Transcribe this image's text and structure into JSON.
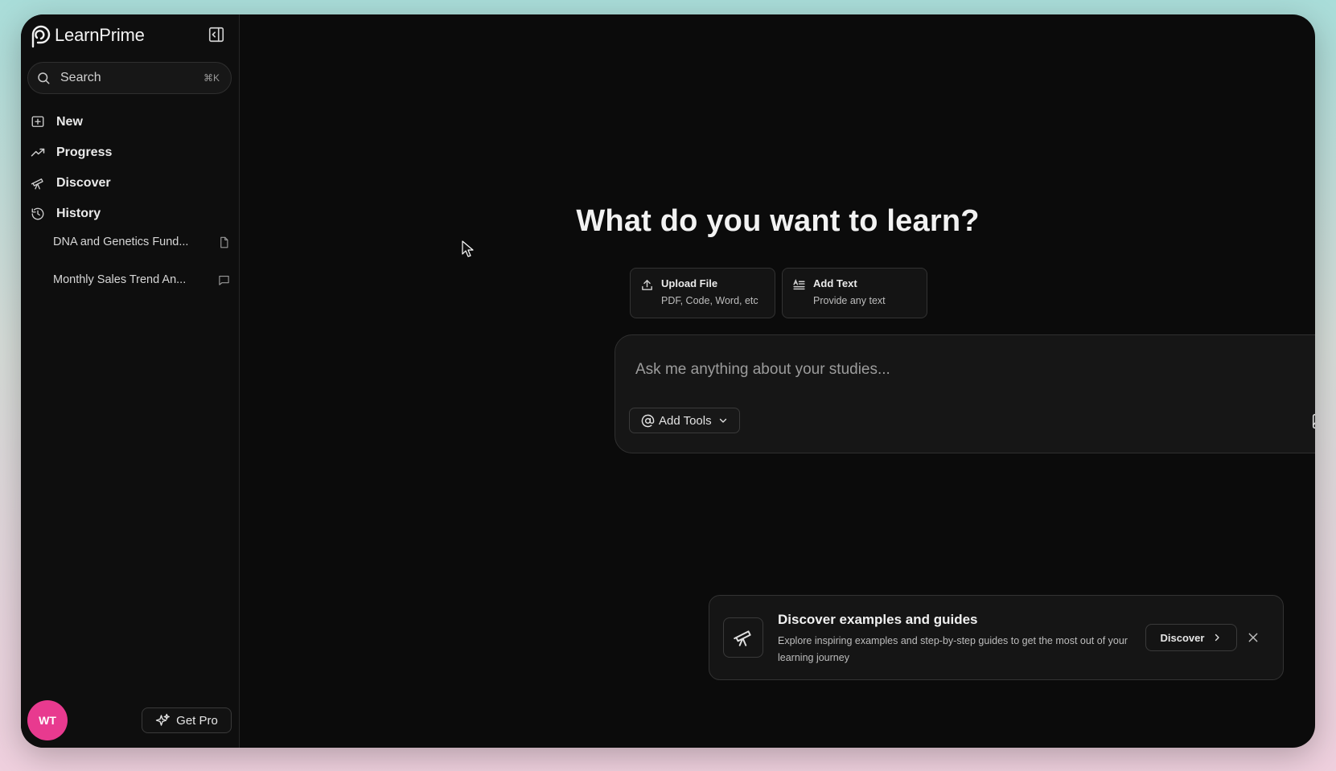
{
  "app": {
    "name": "LearnPrime"
  },
  "sidebar": {
    "search": {
      "label": "Search",
      "shortcut": "⌘K"
    },
    "nav": [
      {
        "label": "New",
        "icon": "plus-square-icon"
      },
      {
        "label": "Progress",
        "icon": "trending-up-icon"
      },
      {
        "label": "Discover",
        "icon": "telescope-icon"
      },
      {
        "label": "History",
        "icon": "history-icon"
      }
    ],
    "history": [
      {
        "label": "DNA and Genetics Fund...",
        "icon": "document-icon"
      },
      {
        "label": "Monthly Sales Trend An...",
        "icon": "chat-icon"
      }
    ],
    "avatar_initials": "WT",
    "get_pro_label": "Get Pro"
  },
  "main": {
    "headline": "What do you want to learn?",
    "chips": [
      {
        "title": "Upload File",
        "subtitle": "PDF, Code, Word, etc",
        "icon": "upload-icon"
      },
      {
        "title": "Add Text",
        "subtitle": "Provide any text",
        "icon": "text-icon"
      }
    ],
    "composer": {
      "placeholder": "Ask me anything about your studies...",
      "add_tools_label": "Add Tools"
    },
    "banner": {
      "title": "Discover examples and guides",
      "description": "Explore inspiring examples and step-by-step guides to get the most out of your learning journey",
      "button_label": "Discover"
    }
  },
  "colors": {
    "background": "#0b0b0b",
    "avatar": "#e83a8f",
    "send_button": "#6f6f6f"
  }
}
